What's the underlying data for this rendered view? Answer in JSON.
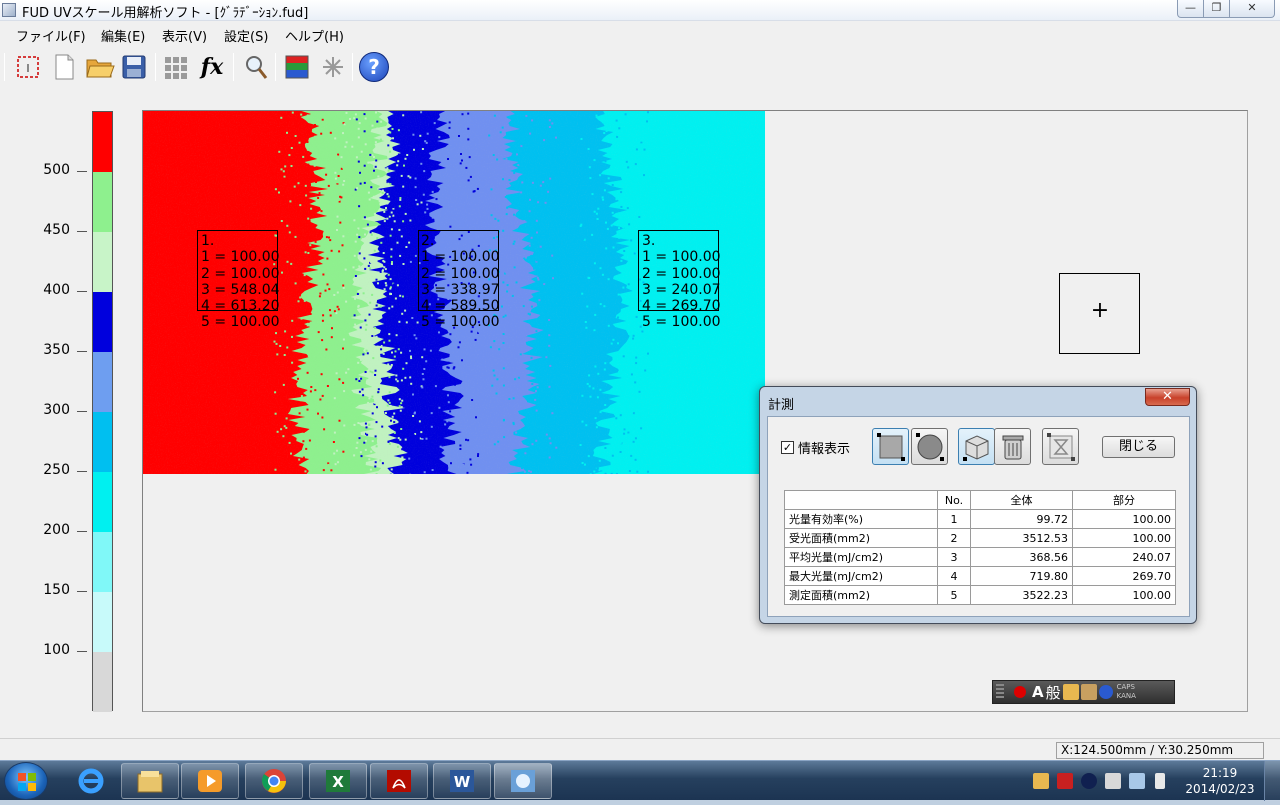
{
  "window": {
    "title": "FUD UVスケール用解析ソフト  - [ｸﾞﾗﾃﾞｰｼｮﾝ.fud]",
    "min_glyph": "—",
    "max_glyph": "❐",
    "close_glyph": "✕"
  },
  "menu": [
    {
      "label": "ファイル(F)"
    },
    {
      "label": "編集(E)"
    },
    {
      "label": "表示(V)"
    },
    {
      "label": "設定(S)"
    },
    {
      "label": "ヘルプ(H)"
    }
  ],
  "toolbar": {
    "icons": [
      "select-area-icon",
      "new-file-icon",
      "open-folder-icon",
      "save-icon",
      "grid-icon",
      "function-icon",
      "magnifier-icon",
      "color-scale-icon",
      "sparkle-icon",
      "help-icon"
    ],
    "fx_label": "fx",
    "help_label": "?"
  },
  "legend": {
    "ticks": [
      "500",
      "450",
      "400",
      "350",
      "300",
      "250",
      "200",
      "150",
      "100"
    ],
    "colors": [
      "#ff0000",
      "#8ef08e",
      "#c8f4c8",
      "#0000dd",
      "#6e9ef0",
      "#00bff0",
      "#00f0f0",
      "#80f8f8",
      "#c8fafa",
      "#d8d8d8"
    ]
  },
  "heatmap": {
    "bands": [
      "#ff0000",
      "#8ef08e",
      "#c0f2c0",
      "#0000dd",
      "#7090f0",
      "#00c0f0",
      "#00f0f0"
    ]
  },
  "rois": [
    {
      "text": "1.\n1 = 100.00\n2 = 100.00\n3 = 548.04\n4 = 613.20\n5 = 100.00"
    },
    {
      "text": "2.\n1 = 100.00\n2 = 100.00\n3 = 338.97\n4 = 589.50\n5 = 100.00"
    },
    {
      "text": "3.\n1 = 100.00\n2 = 100.00\n3 = 240.07\n4 = 269.70\n5 = 100.00"
    }
  ],
  "crosshair": "+",
  "dialog": {
    "title": "計測",
    "close_glyph": "✕",
    "checkbox_label": "情報表示",
    "checkbox_checked": "✓",
    "close_button": "閉じる",
    "table": {
      "headers": [
        "",
        "No.",
        "全体",
        "部分"
      ],
      "rows": [
        [
          "光量有効率(%)",
          "1",
          "99.72",
          "100.00"
        ],
        [
          "受光面積(mm2)",
          "2",
          "3512.53",
          "100.00"
        ],
        [
          "平均光量(mJ/cm2)",
          "3",
          "368.56",
          "240.07"
        ],
        [
          "最大光量(mJ/cm2)",
          "4",
          "719.80",
          "269.70"
        ],
        [
          "測定面積(mm2)",
          "5",
          "3522.23",
          "100.00"
        ]
      ]
    }
  },
  "ime": {
    "a_label": "A",
    "han_label": "般",
    "caps_label": "CAPS",
    "kana_label": "KANA"
  },
  "status": {
    "coords": "X:124.500mm / Y:30.250mm"
  },
  "taskbar": {
    "apps": [
      "ie-icon",
      "explorer-icon",
      "media-player-icon",
      "chrome-icon",
      "excel-icon",
      "acrobat-icon",
      "word-icon",
      "app-icon"
    ],
    "time": "21:19",
    "date": "2014/02/23"
  }
}
